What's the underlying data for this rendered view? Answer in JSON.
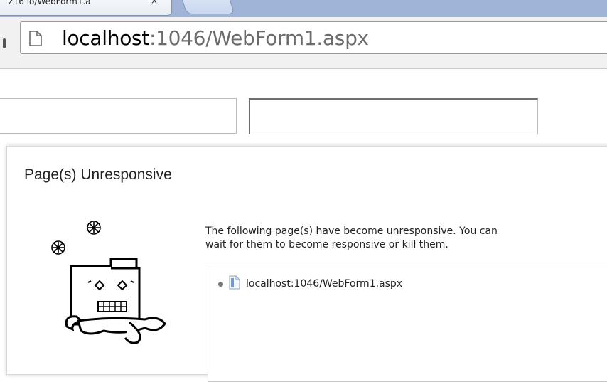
{
  "browser": {
    "tab": {
      "title": "216 lo/WebForm1.a",
      "close_glyph": "×"
    },
    "new_tab_label": "",
    "omnibox": {
      "host": "localhost",
      "rest": ":1046/WebForm1.aspx",
      "icon": "page-icon"
    }
  },
  "page": {
    "field1_value": "",
    "field2_value": ""
  },
  "dialog": {
    "title": "Page(s) Unresponsive",
    "message_line1": "The following page(s) have become unresponsive. You can",
    "message_line2": "wait for them to become responsive or kill them.",
    "pages": [
      {
        "label": "localhost:1046/WebForm1.aspx",
        "icon": "document-icon"
      }
    ],
    "art_icon": "frozen-folder-icon"
  },
  "colors": {
    "tabstrip": "#9fb4d6",
    "toolbar": "#f1f1f1",
    "url_host": "#000000",
    "url_rest": "#6c6c6c"
  }
}
